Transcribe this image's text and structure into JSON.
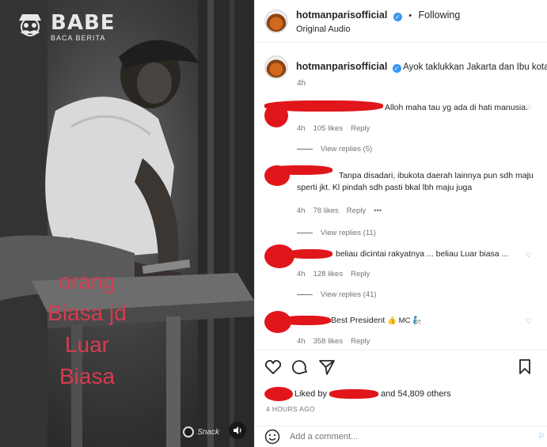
{
  "media": {
    "logo_title": "BABE",
    "logo_sub": "BACA BERITA",
    "caption_lines": [
      "orang",
      "Biasa jd",
      "Luar",
      "Biasa"
    ],
    "watermark": "Snack",
    "caption_color": "#d63c4f"
  },
  "header": {
    "username": "hotmanparisofficial",
    "verified_icon": "✓",
    "follow_label": "Following",
    "audio": "Original Audio"
  },
  "post": {
    "caption_username": "hotmanparisofficial",
    "caption_text": "Ayok taklukkan Jakarta dan Ibu kota baru",
    "caption_time": "4h"
  },
  "comments": [
    {
      "text": "Alloh maha tau yg ada di hati manusia.",
      "time": "4h",
      "likes": "105 likes",
      "reply_label": "Reply",
      "view_replies": "View replies (5)"
    },
    {
      "text_line1": "Tanpa disadari, ibukota daerah lainnya pun sdh maju",
      "text_line2": "sperti jkt. Kl pindah sdh pasti bkal lbh maju juga",
      "time": "4h",
      "likes": "78 likes",
      "reply_label": "Reply",
      "more": "•••",
      "view_replies": "View replies (11)"
    },
    {
      "text": "beliau dicintai rakyatnya ... beliau Luar biasa ...",
      "time": "4h",
      "likes": "128 likes",
      "reply_label": "Reply",
      "view_replies": "View replies (41)"
    },
    {
      "text": "Best President",
      "emoji": "👍 MC 🧞",
      "time": "4h",
      "likes": "358 likes",
      "reply_label": "Reply"
    }
  ],
  "actions": {
    "liked_by": "Liked by",
    "and_others": "and 54,809 others",
    "time_ago": "4 HOURS AGO",
    "add_comment_placeholder": "Add a comment...",
    "post_label": "P"
  },
  "colors": {
    "redaction": "#e0161b",
    "verified": "#3797f0",
    "muted": "#737373"
  }
}
